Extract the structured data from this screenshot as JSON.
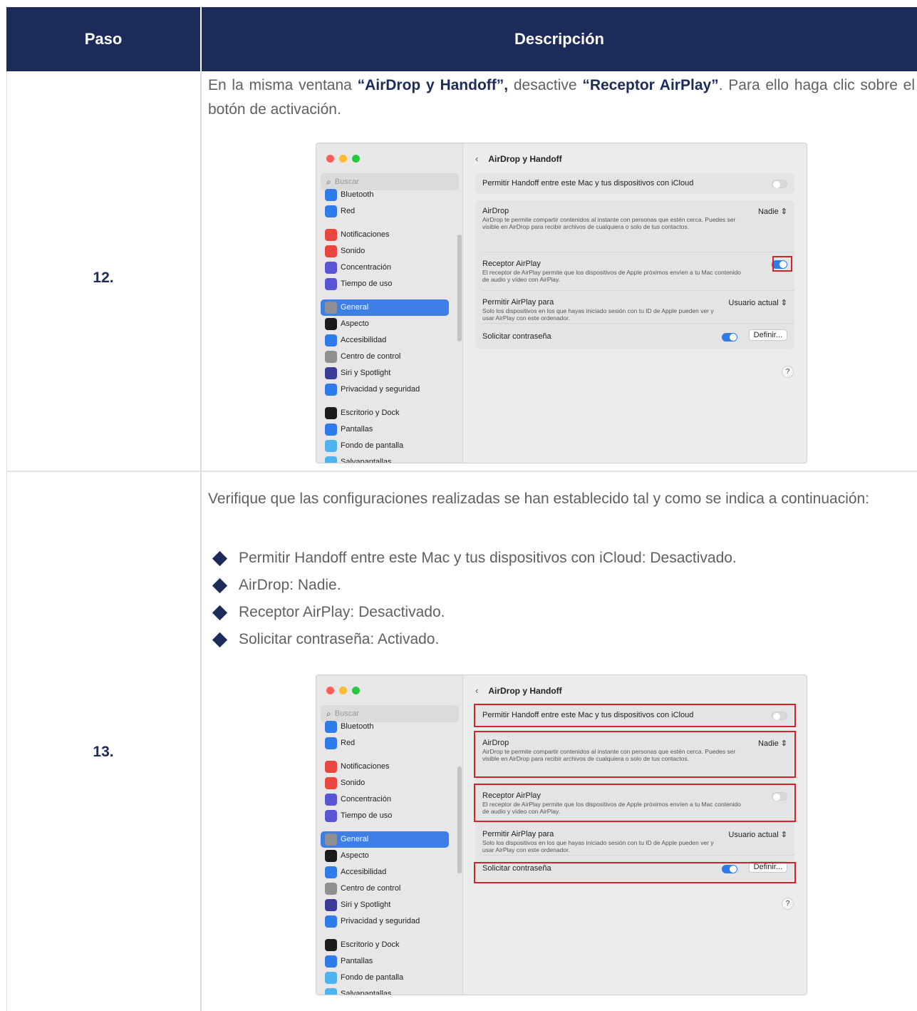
{
  "table": {
    "header": {
      "paso": "Paso",
      "descripcion": "Descripción"
    },
    "rows": [
      {
        "step": "12.",
        "text_parts": [
          "En la misma ventana ",
          "“AirDrop y Handoff”,",
          " desactive ",
          "“Receptor AirPlay”",
          ". Para ello haga clic sobre el botón de activación."
        ]
      },
      {
        "step": "13.",
        "intro": "Verifique que las configuraciones realizadas se han establecido tal y como se indica a continuación:",
        "bullets": [
          "Permitir Handoff entre este Mac y tus dispositivos con iCloud: Desactivado.",
          "AirDrop: Nadie.",
          "Receptor AirPlay: Desactivado.",
          "Solicitar contraseña: Activado."
        ]
      }
    ]
  },
  "mac_window": {
    "search_placeholder": "Buscar",
    "sidebar_items": [
      {
        "label": "Bluetooth",
        "icon": "bluetooth-icon",
        "color": "#2f7bea"
      },
      {
        "label": "Red",
        "icon": "globe-icon",
        "color": "#2f7bea"
      },
      {
        "label": "Notificaciones",
        "icon": "bell-icon",
        "color": "#e8463f"
      },
      {
        "label": "Sonido",
        "icon": "speaker-icon",
        "color": "#e8463f"
      },
      {
        "label": "Concentración",
        "icon": "moon-icon",
        "color": "#5856d6"
      },
      {
        "label": "Tiempo de uso",
        "icon": "hourglass-icon",
        "color": "#5856d6"
      },
      {
        "label": "General",
        "icon": "gear-icon",
        "color": "#8e8e93"
      },
      {
        "label": "Aspecto",
        "icon": "appearance-icon",
        "color": "#1c1c1e"
      },
      {
        "label": "Accesibilidad",
        "icon": "accessibility-icon",
        "color": "#2f7bea"
      },
      {
        "label": "Centro de control",
        "icon": "control-center-icon",
        "color": "#8e8e93"
      },
      {
        "label": "Siri y Spotlight",
        "icon": "siri-icon",
        "color": "#3b3b98"
      },
      {
        "label": "Privacidad y seguridad",
        "icon": "hand-icon",
        "color": "#2f7bea"
      },
      {
        "label": "Escritorio y Dock",
        "icon": "dock-icon",
        "color": "#1c1c1e"
      },
      {
        "label": "Pantallas",
        "icon": "sun-icon",
        "color": "#2f7bea"
      },
      {
        "label": "Fondo de pantalla",
        "icon": "wallpaper-icon",
        "color": "#4fb3f0"
      },
      {
        "label": "Salvapantallas",
        "icon": "screensaver-icon",
        "color": "#4fb3f0"
      }
    ],
    "title": "AirDrop y Handoff",
    "handoff_label": "Permitir Handoff entre este Mac y tus dispositivos con iCloud",
    "airdrop_label": "AirDrop",
    "airdrop_desc": "AirDrop te permite compartir contenidos al instante con personas que estén cerca. Puedes ser visible en AirDrop para recibir archivos de cualquiera o solo de tus contactos.",
    "airdrop_value": "Nadie",
    "airplay_label": "Receptor AirPlay",
    "airplay_desc": "El receptor de AirPlay permite que los dispositivos de Apple próximos envíen a tu Mac contenido de audio y vídeo con AirPlay.",
    "allow_airplay_label": "Permitir AirPlay para",
    "allow_airplay_desc": "Solo los dispositivos en los que hayas iniciado sesión con tu ID de Apple pueden ver y usar AirPlay con este ordenador.",
    "allow_airplay_value": "Usuario actual",
    "password_label": "Solicitar contraseña",
    "define_button": "Definir...",
    "help": "?",
    "window1_airplay_on": true,
    "window2_airplay_on": false,
    "colors": {
      "header": "#1c2b5a",
      "accent": "#2f7bea",
      "highlight": "#d2232a"
    }
  }
}
